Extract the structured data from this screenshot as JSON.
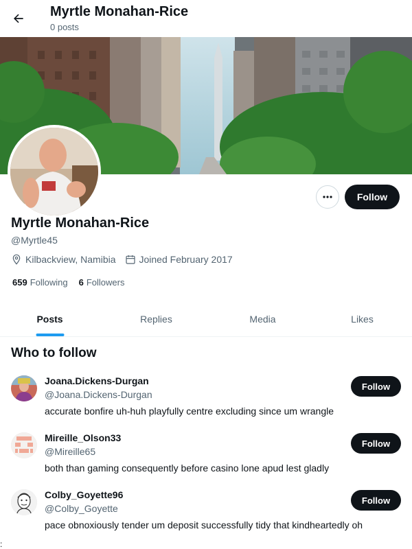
{
  "header": {
    "name": "Myrtle Monahan-Rice",
    "post_count": "0 posts"
  },
  "profile": {
    "name": "Myrtle Monahan-Rice",
    "handle": "@Myrtle45",
    "location": "Kilbackview, Namibia",
    "joined": "Joined February 2017",
    "following_count": "659",
    "following_label": "Following",
    "followers_count": "6",
    "followers_label": "Followers",
    "follow_label": "Follow",
    "more_icon": "more-horizontal-icon"
  },
  "tabs": [
    {
      "label": "Posts",
      "active": true
    },
    {
      "label": "Replies",
      "active": false
    },
    {
      "label": "Media",
      "active": false
    },
    {
      "label": "Likes",
      "active": false
    }
  ],
  "who_to_follow": {
    "title": "Who to follow",
    "users": [
      {
        "name": "Joana.Dickens-Durgan",
        "handle": "@Joana.Dickens-Durgan",
        "bio": "accurate bonfire uh-huh playfully centre excluding since um wrangle",
        "follow_label": "Follow"
      },
      {
        "name": "Mireille_Olson33",
        "handle": "@Mireille65",
        "bio": "both than gaming consequently before casino lone apud lest gladly",
        "follow_label": "Follow"
      },
      {
        "name": "Colby_Goyette96",
        "handle": "@Colby_Goyette",
        "bio": "pace obnoxiously tender um deposit successfully tidy that kindheartedly oh",
        "follow_label": "Follow"
      }
    ]
  },
  "colors": {
    "accent": "#1d9bf0",
    "text": "#0f1419",
    "secondary_text": "#536471",
    "button_bg": "#0f1419"
  },
  "stray_char": ":"
}
